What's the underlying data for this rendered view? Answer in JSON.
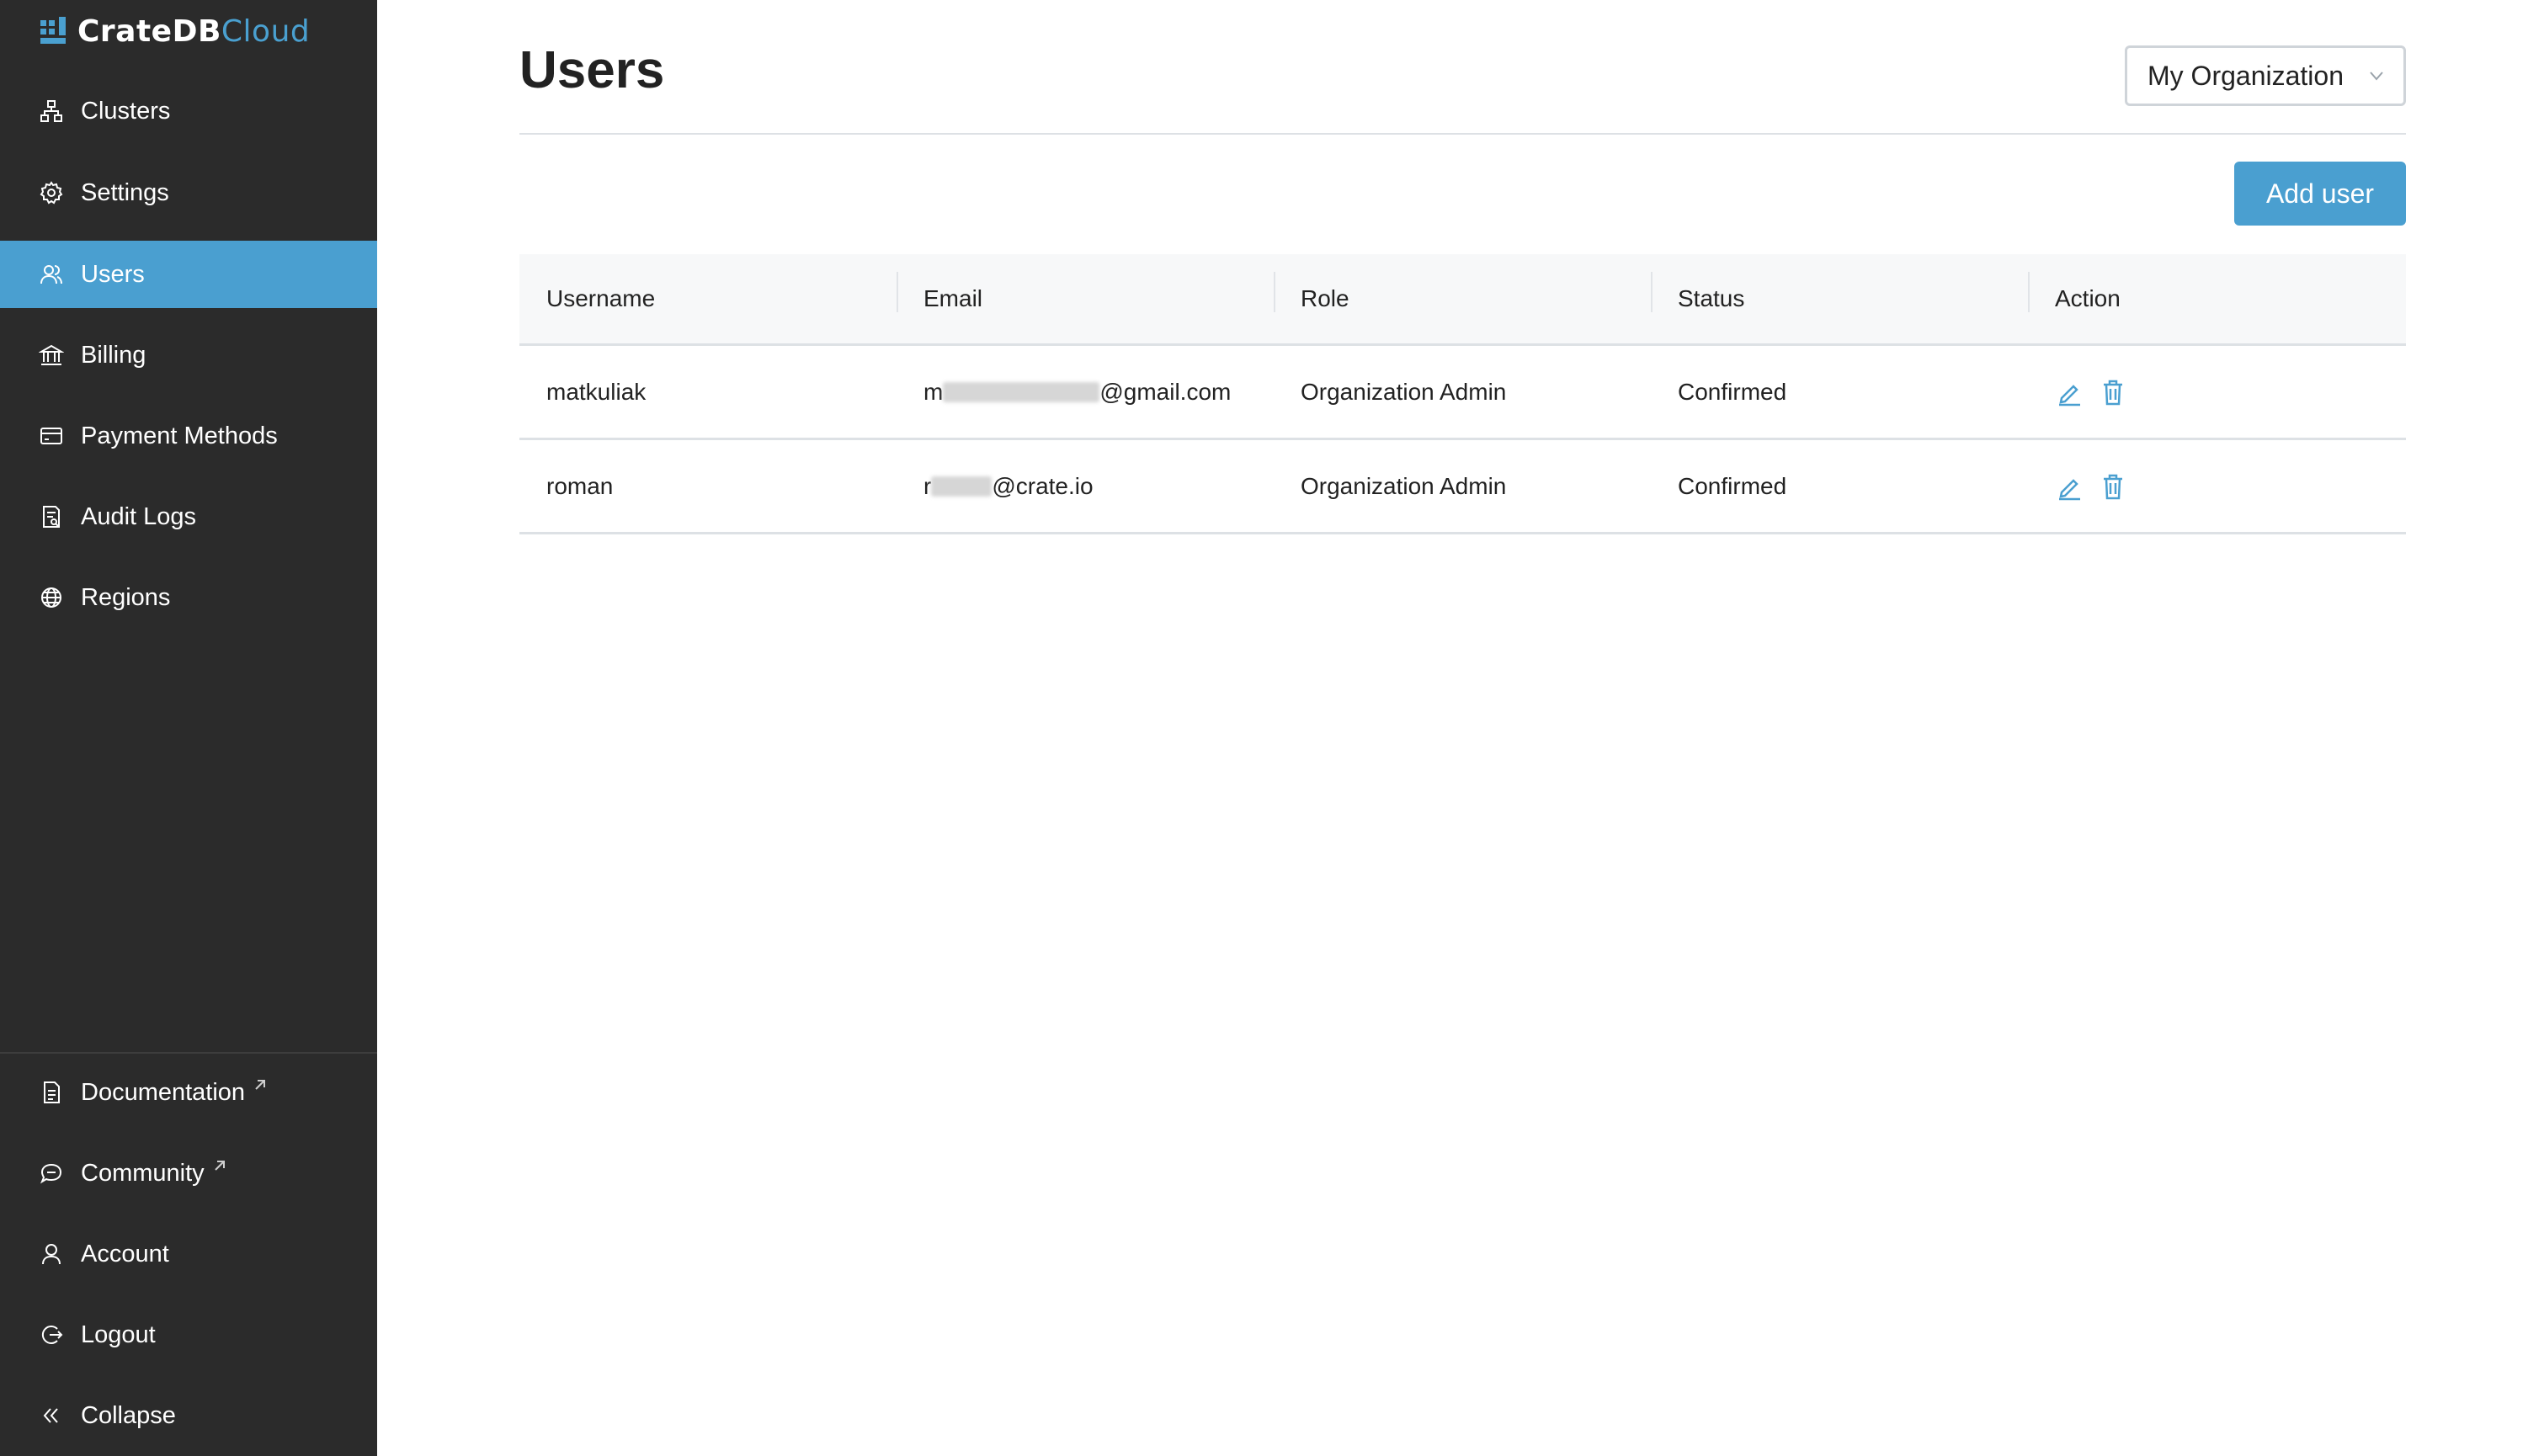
{
  "app": {
    "logo_name_a": "CrateDB",
    "logo_name_b": "Cloud"
  },
  "sidebar": {
    "items": [
      {
        "label": "Clusters",
        "icon": "clusters-icon"
      },
      {
        "label": "Settings",
        "icon": "gear-icon"
      },
      {
        "label": "Users",
        "icon": "users-icon",
        "active": true
      },
      {
        "label": "Billing",
        "icon": "bank-icon"
      },
      {
        "label": "Payment Methods",
        "icon": "credit-card-icon"
      },
      {
        "label": "Audit Logs",
        "icon": "audit-log-icon"
      },
      {
        "label": "Regions",
        "icon": "globe-icon"
      }
    ],
    "bottom_items": [
      {
        "label": "Documentation",
        "icon": "document-icon",
        "external": true
      },
      {
        "label": "Community",
        "icon": "chat-icon",
        "external": true
      },
      {
        "label": "Account",
        "icon": "user-icon"
      },
      {
        "label": "Logout",
        "icon": "logout-icon"
      },
      {
        "label": "Collapse",
        "icon": "double-chevron-left-icon"
      }
    ]
  },
  "header": {
    "title": "Users",
    "org_select_value": "My Organization"
  },
  "toolbar": {
    "add_user_label": "Add user"
  },
  "table": {
    "columns": [
      "Username",
      "Email",
      "Role",
      "Status",
      "Action"
    ],
    "rows": [
      {
        "username": "matkuliak",
        "email_prefix": "m",
        "email_suffix": "@gmail.com",
        "role": "Organization Admin",
        "status": "Confirmed"
      },
      {
        "username": "roman",
        "email_prefix": "r",
        "email_suffix": "@crate.io",
        "role": "Organization Admin",
        "status": "Confirmed"
      }
    ]
  },
  "colors": {
    "sidebar_bg": "#2b2b2b",
    "accent": "#4a9fd0"
  }
}
